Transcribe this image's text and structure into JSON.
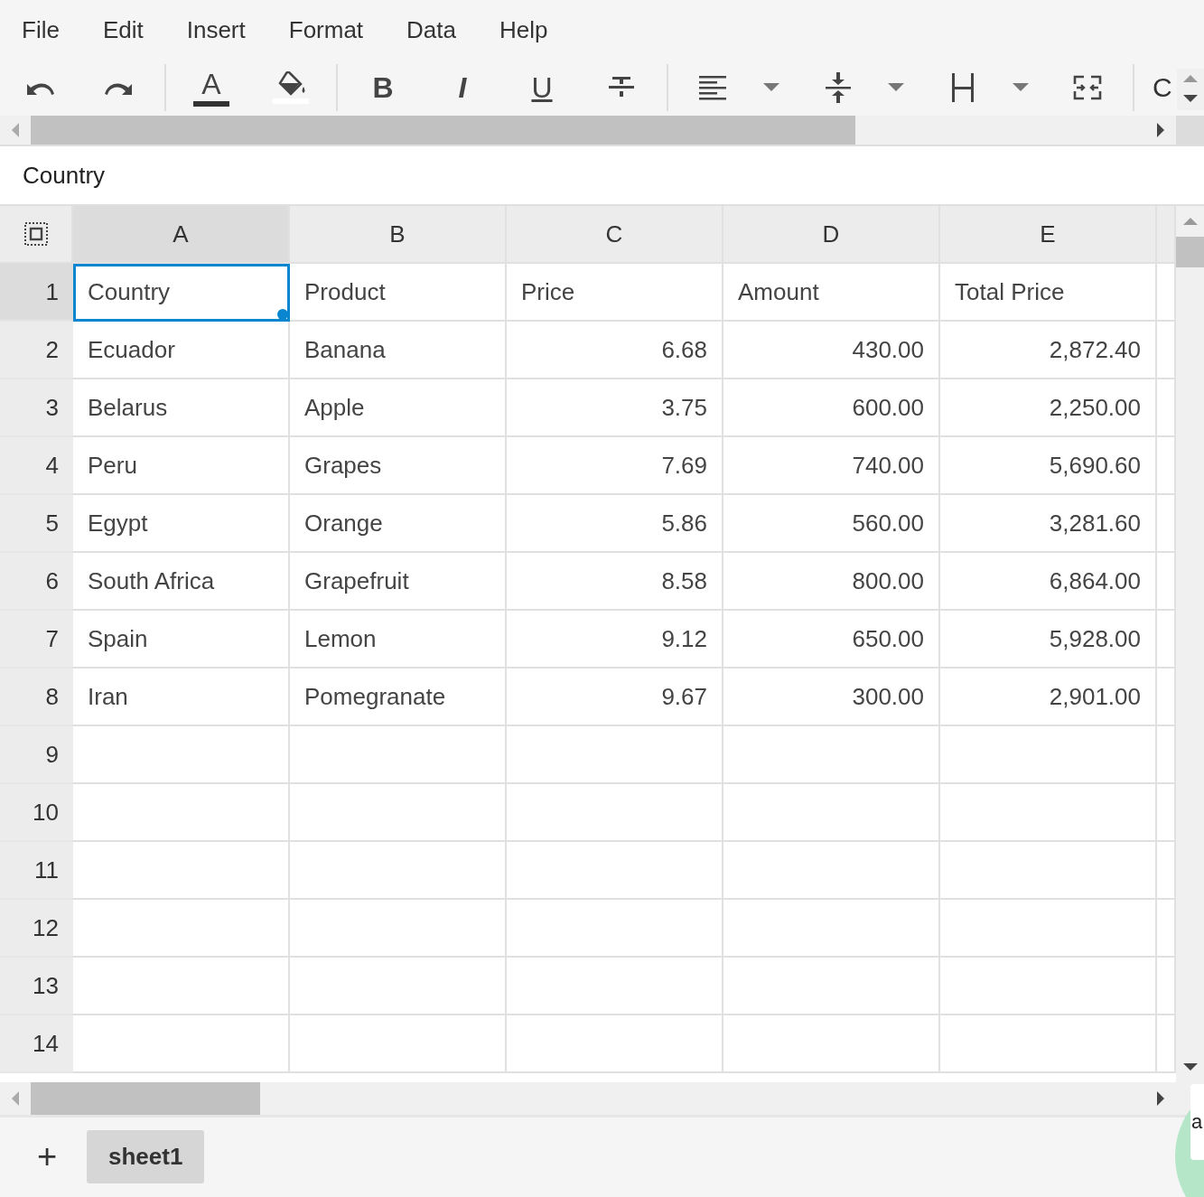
{
  "menu": [
    {
      "label": "File"
    },
    {
      "label": "Edit"
    },
    {
      "label": "Insert"
    },
    {
      "label": "Format"
    },
    {
      "label": "Data"
    },
    {
      "label": "Help"
    }
  ],
  "toolbar": [
    {
      "kind": "undo"
    },
    {
      "kind": "redo"
    },
    {
      "kind": "separator"
    },
    {
      "kind": "font-color",
      "label": "A"
    },
    {
      "kind": "fill-color"
    },
    {
      "kind": "separator"
    },
    {
      "kind": "bold",
      "label": "B"
    },
    {
      "kind": "italic",
      "label": "I"
    },
    {
      "kind": "underline",
      "label": "U"
    },
    {
      "kind": "strike"
    },
    {
      "kind": "separator"
    },
    {
      "kind": "align",
      "dropdown": true
    },
    {
      "kind": "valign",
      "dropdown": true
    },
    {
      "kind": "wrap",
      "dropdown": true
    },
    {
      "kind": "merge"
    },
    {
      "kind": "separator"
    },
    {
      "kind": "text",
      "label": "C"
    }
  ],
  "formula_bar": {
    "value": "Country"
  },
  "columns": [
    {
      "label": "A",
      "selected": true
    },
    {
      "label": "B",
      "selected": false
    },
    {
      "label": "C",
      "selected": false
    },
    {
      "label": "D",
      "selected": false
    },
    {
      "label": "E",
      "selected": false
    }
  ],
  "rows": [
    {
      "number": "1",
      "selected": true,
      "cells": [
        {
          "value": "Country",
          "kind": "text",
          "selected": true
        },
        {
          "value": "Product",
          "kind": "text",
          "selected": false
        },
        {
          "value": "Price",
          "kind": "text",
          "selected": false
        },
        {
          "value": "Amount",
          "kind": "text",
          "selected": false
        },
        {
          "value": "Total Price",
          "kind": "text",
          "selected": false
        }
      ]
    },
    {
      "number": "2",
      "selected": false,
      "cells": [
        {
          "value": "Ecuador",
          "kind": "text",
          "selected": false
        },
        {
          "value": "Banana",
          "kind": "text",
          "selected": false
        },
        {
          "value": "6.68",
          "kind": "number",
          "selected": false
        },
        {
          "value": "430.00",
          "kind": "number",
          "selected": false
        },
        {
          "value": "2,872.40",
          "kind": "number",
          "selected": false
        }
      ]
    },
    {
      "number": "3",
      "selected": false,
      "cells": [
        {
          "value": "Belarus",
          "kind": "text",
          "selected": false
        },
        {
          "value": "Apple",
          "kind": "text",
          "selected": false
        },
        {
          "value": "3.75",
          "kind": "number",
          "selected": false
        },
        {
          "value": "600.00",
          "kind": "number",
          "selected": false
        },
        {
          "value": "2,250.00",
          "kind": "number",
          "selected": false
        }
      ]
    },
    {
      "number": "4",
      "selected": false,
      "cells": [
        {
          "value": "Peru",
          "kind": "text",
          "selected": false
        },
        {
          "value": "Grapes",
          "kind": "text",
          "selected": false
        },
        {
          "value": "7.69",
          "kind": "number",
          "selected": false
        },
        {
          "value": "740.00",
          "kind": "number",
          "selected": false
        },
        {
          "value": "5,690.60",
          "kind": "number",
          "selected": false
        }
      ]
    },
    {
      "number": "5",
      "selected": false,
      "cells": [
        {
          "value": "Egypt",
          "kind": "text",
          "selected": false
        },
        {
          "value": "Orange",
          "kind": "text",
          "selected": false
        },
        {
          "value": "5.86",
          "kind": "number",
          "selected": false
        },
        {
          "value": "560.00",
          "kind": "number",
          "selected": false
        },
        {
          "value": "3,281.60",
          "kind": "number",
          "selected": false
        }
      ]
    },
    {
      "number": "6",
      "selected": false,
      "cells": [
        {
          "value": "South Africa",
          "kind": "text",
          "selected": false
        },
        {
          "value": "Grapefruit",
          "kind": "text",
          "selected": false
        },
        {
          "value": "8.58",
          "kind": "number",
          "selected": false
        },
        {
          "value": "800.00",
          "kind": "number",
          "selected": false
        },
        {
          "value": "6,864.00",
          "kind": "number",
          "selected": false
        }
      ]
    },
    {
      "number": "7",
      "selected": false,
      "cells": [
        {
          "value": "Spain",
          "kind": "text",
          "selected": false
        },
        {
          "value": "Lemon",
          "kind": "text",
          "selected": false
        },
        {
          "value": "9.12",
          "kind": "number",
          "selected": false
        },
        {
          "value": "650.00",
          "kind": "number",
          "selected": false
        },
        {
          "value": "5,928.00",
          "kind": "number",
          "selected": false
        }
      ]
    },
    {
      "number": "8",
      "selected": false,
      "cells": [
        {
          "value": "Iran",
          "kind": "text",
          "selected": false
        },
        {
          "value": "Pomegranate",
          "kind": "text",
          "selected": false
        },
        {
          "value": "9.67",
          "kind": "number",
          "selected": false
        },
        {
          "value": "300.00",
          "kind": "number",
          "selected": false
        },
        {
          "value": "2,901.00",
          "kind": "number",
          "selected": false
        }
      ]
    },
    {
      "number": "9",
      "selected": false
    },
    {
      "number": "10",
      "selected": false
    },
    {
      "number": "11",
      "selected": false
    },
    {
      "number": "12",
      "selected": false
    },
    {
      "number": "13",
      "selected": false
    },
    {
      "number": "14",
      "selected": false
    }
  ],
  "sheet_tabs": {
    "add_label": "+",
    "tabs": [
      {
        "label": "sheet1",
        "selected": true
      }
    ]
  },
  "floating_card": {
    "label": "a"
  }
}
